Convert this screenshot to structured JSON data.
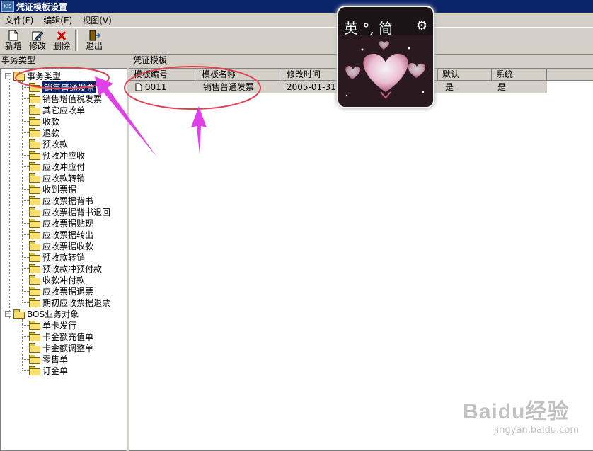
{
  "window": {
    "title": "凭证模板设置",
    "logo_text": "KIS"
  },
  "menu": {
    "items": [
      "文件(F)",
      "编辑(E)",
      "视图(V)"
    ]
  },
  "toolbar": {
    "new_label": "新增",
    "edit_label": "修改",
    "delete_label": "删除",
    "exit_label": "退出"
  },
  "left_panel": {
    "header": "事务类型",
    "root1": "事务类型",
    "root1_children": [
      "销售普通发票",
      "销售增值税发票",
      "其它应收单",
      "收款",
      "退款",
      "预收款",
      "预收冲应收",
      "应收冲应付",
      "应收款转销",
      "收到票据",
      "应收票据背书",
      "应收票据背书退回",
      "应收票据贴现",
      "应收票据转出",
      "应收票据收款",
      "预收款转销",
      "预收款冲预付款",
      "收款冲付款",
      "应收票据退票",
      "期初应收票据退票"
    ],
    "root2": "BOS业务对象",
    "root2_children": [
      "单卡发行",
      "卡金额充值单",
      "卡金额调整单",
      "零售单",
      "订金单"
    ]
  },
  "right_panel": {
    "header": "凭证模板",
    "columns": [
      "模板编号",
      "模板名称",
      "修改时间",
      "默认",
      "系统"
    ],
    "rows": [
      {
        "code": "0011",
        "name": "销售普通发票",
        "time": "2005-01-31 1",
        "default": "是",
        "system": "是"
      }
    ]
  },
  "overlay": {
    "text": "英 °, 简"
  },
  "watermark": {
    "brand": "Baidu经验",
    "url": "jingyan.baidu.com"
  },
  "colors": {
    "title_bg": "#0a246a",
    "window_bg": "#d4d0c8",
    "selection": "#0a246a",
    "annotation_red": "#e04050",
    "annotation_magenta": "#e040e8"
  }
}
